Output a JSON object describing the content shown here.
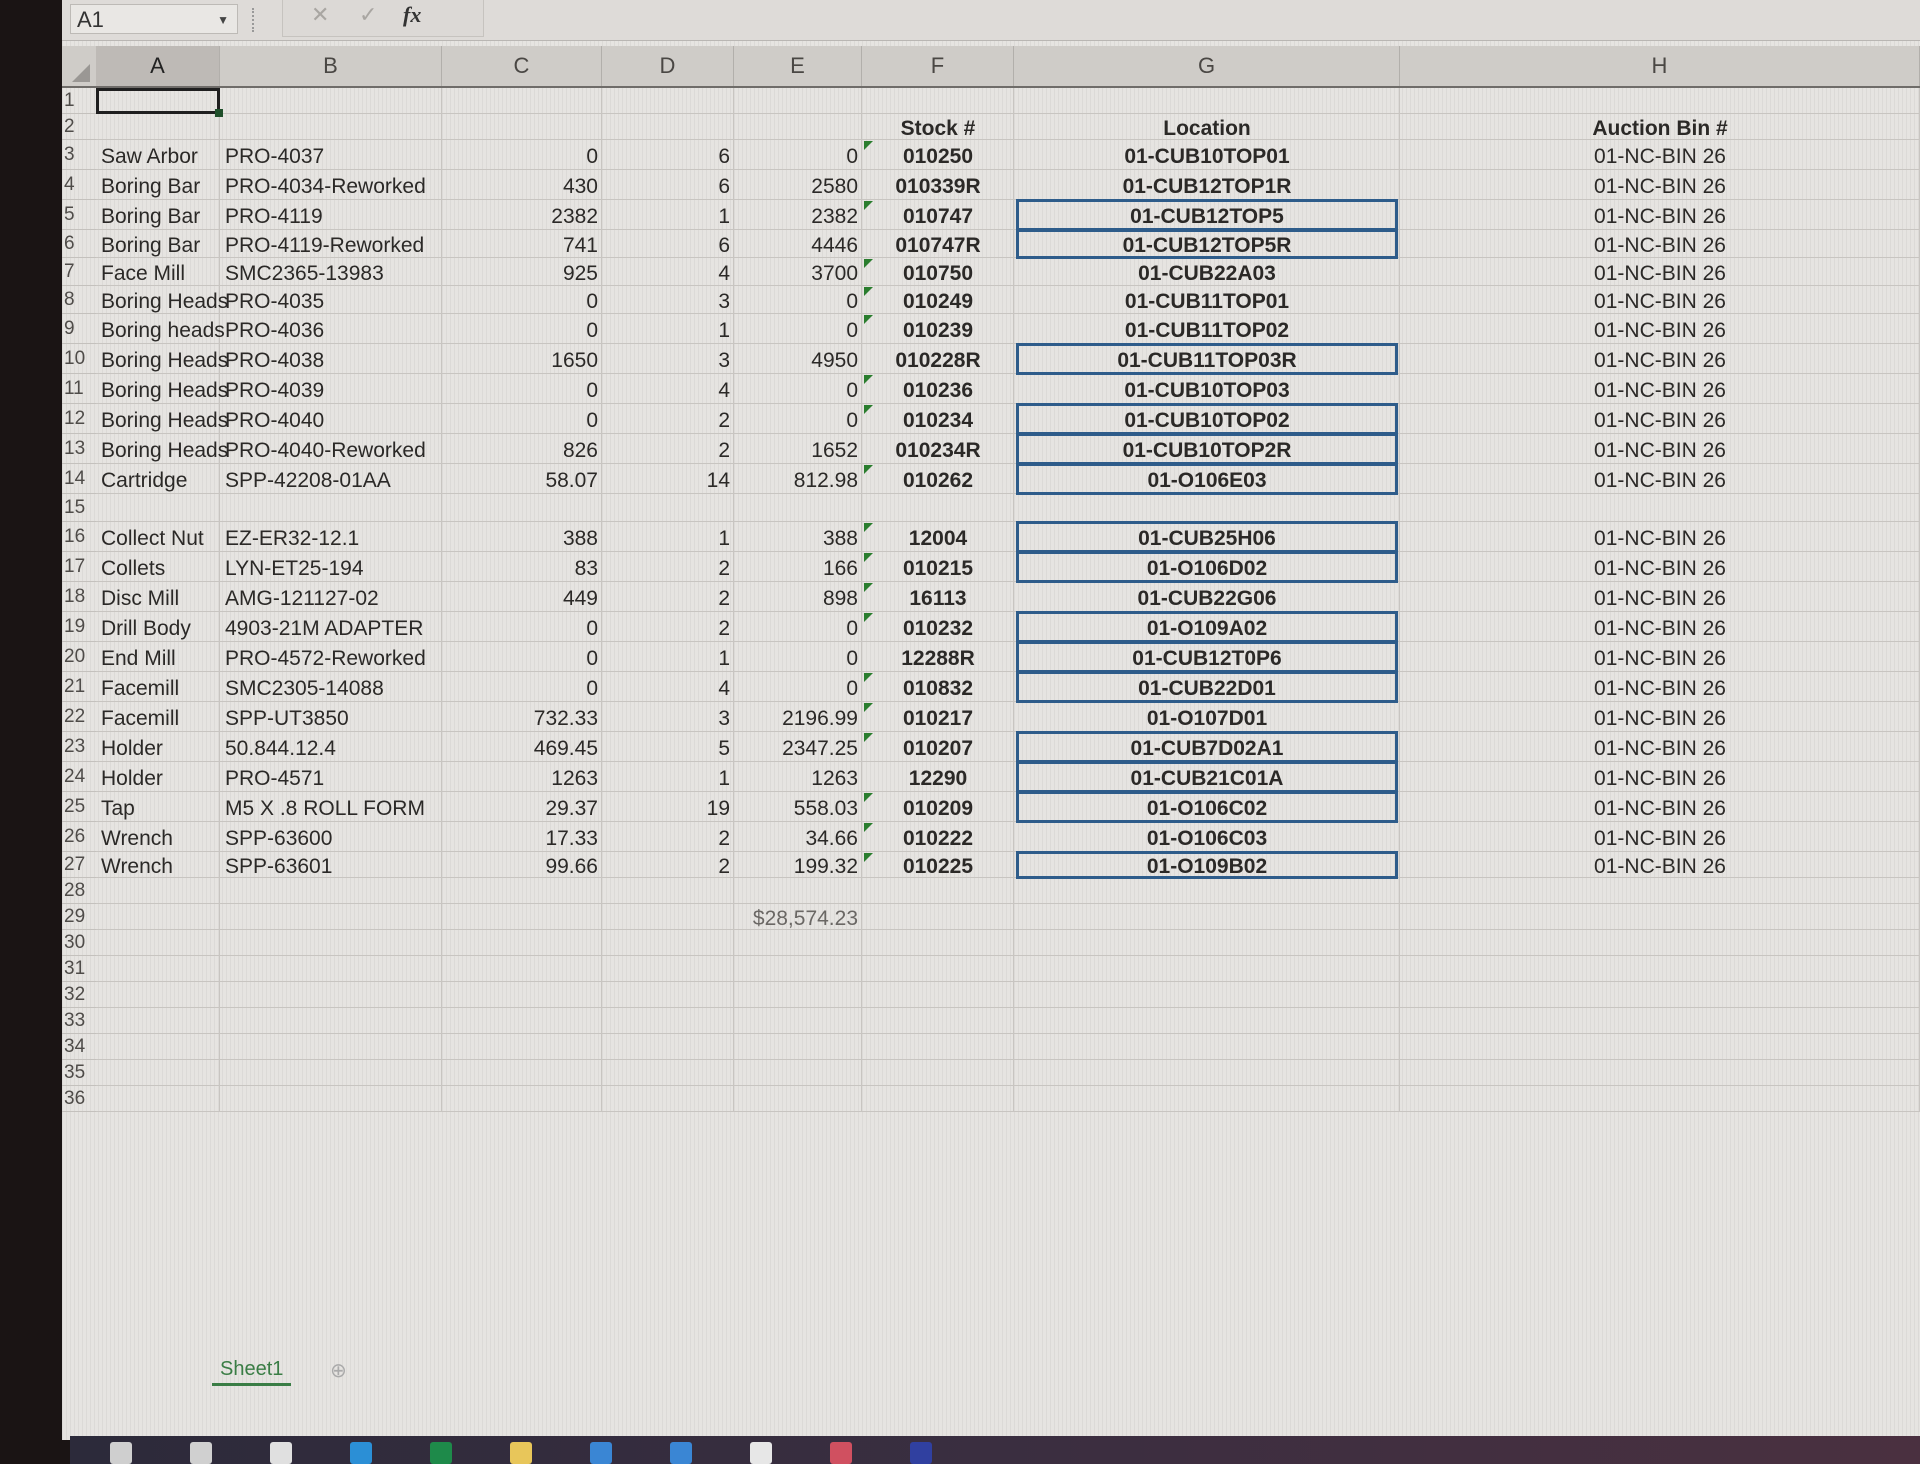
{
  "formula_bar": {
    "name_box": "A1",
    "cancel_icon": "✕",
    "enter_icon": "✓",
    "fx_label": "fx",
    "formula": ""
  },
  "columns": [
    "A",
    "B",
    "C",
    "D",
    "E",
    "F",
    "G",
    "H"
  ],
  "row_numbers": [
    "1",
    "2",
    "3",
    "4",
    "5",
    "6",
    "7",
    "8",
    "9",
    "10",
    "11",
    "12",
    "13",
    "14",
    "15",
    "16",
    "17",
    "18",
    "19",
    "20",
    "21",
    "22",
    "23",
    "24",
    "25",
    "26",
    "27",
    "28",
    "29",
    "30",
    "31",
    "32",
    "33",
    "34",
    "35",
    "36"
  ],
  "headers": {
    "stock": "Stock #",
    "location": "Location",
    "auction_bin": "Auction Bin #"
  },
  "rows": [
    {
      "row": 3,
      "a": "Saw Arbor",
      "b": "PRO-4037",
      "c": "0",
      "d": "6",
      "e": "0",
      "f": "010250",
      "g": "01-CUB10TOP01",
      "h": "01-NC-BIN 26",
      "flag": true,
      "boxed": false
    },
    {
      "row": 4,
      "a": "Boring Bar",
      "b": "PRO-4034-Reworked",
      "c": "430",
      "d": "6",
      "e": "2580",
      "f": "010339R",
      "g": "01-CUB12TOP1R",
      "h": "01-NC-BIN 26",
      "flag": false,
      "boxed": false
    },
    {
      "row": 5,
      "a": "Boring Bar",
      "b": "PRO-4119",
      "c": "2382",
      "d": "1",
      "e": "2382",
      "f": "010747",
      "g": "01-CUB12TOP5",
      "h": "01-NC-BIN 26",
      "flag": true,
      "boxed": true
    },
    {
      "row": 6,
      "a": "Boring Bar",
      "b": "PRO-4119-Reworked",
      "c": "741",
      "d": "6",
      "e": "4446",
      "f": "010747R",
      "g": "01-CUB12TOP5R",
      "h": "01-NC-BIN 26",
      "flag": false,
      "boxed": true
    },
    {
      "row": 7,
      "a": "Face Mill",
      "b": "SMC2365-13983",
      "c": "925",
      "d": "4",
      "e": "3700",
      "f": "010750",
      "g": "01-CUB22A03",
      "h": "01-NC-BIN 26",
      "flag": true,
      "boxed": false
    },
    {
      "row": 8,
      "a": "Boring Heads",
      "b": "PRO-4035",
      "c": "0",
      "d": "3",
      "e": "0",
      "f": "010249",
      "g": "01-CUB11TOP01",
      "h": "01-NC-BIN 26",
      "flag": true,
      "boxed": false
    },
    {
      "row": 9,
      "a": "Boring heads",
      "b": "PRO-4036",
      "c": "0",
      "d": "1",
      "e": "0",
      "f": "010239",
      "g": "01-CUB11TOP02",
      "h": "01-NC-BIN 26",
      "flag": true,
      "boxed": false
    },
    {
      "row": 10,
      "a": "Boring Heads",
      "b": "PRO-4038",
      "c": "1650",
      "d": "3",
      "e": "4950",
      "f": "010228R",
      "g": "01-CUB11TOP03R",
      "h": "01-NC-BIN 26",
      "flag": false,
      "boxed": true
    },
    {
      "row": 11,
      "a": "Boring Heads",
      "b": "PRO-4039",
      "c": "0",
      "d": "4",
      "e": "0",
      "f": "010236",
      "g": "01-CUB10TOP03",
      "h": "01-NC-BIN 26",
      "flag": true,
      "boxed": false
    },
    {
      "row": 12,
      "a": "Boring Heads",
      "b": "PRO-4040",
      "c": "0",
      "d": "2",
      "e": "0",
      "f": "010234",
      "g": "01-CUB10TOP02",
      "h": "01-NC-BIN 26",
      "flag": true,
      "boxed": true
    },
    {
      "row": 13,
      "a": "Boring Heads",
      "b": "PRO-4040-Reworked",
      "c": "826",
      "d": "2",
      "e": "1652",
      "f": "010234R",
      "g": "01-CUB10TOP2R",
      "h": "01-NC-BIN 26",
      "flag": false,
      "boxed": true
    },
    {
      "row": 14,
      "a": "Cartridge",
      "b": "SPP-42208-01AA",
      "c": "58.07",
      "d": "14",
      "e": "812.98",
      "f": "010262",
      "g": "01-O106E03",
      "h": "01-NC-BIN 26",
      "flag": true,
      "boxed": true
    },
    {
      "row": 16,
      "a": "Collect Nut",
      "b": "EZ-ER32-12.1",
      "c": "388",
      "d": "1",
      "e": "388",
      "f": "12004",
      "g": "01-CUB25H06",
      "h": "01-NC-BIN 26",
      "flag": true,
      "boxed": true
    },
    {
      "row": 17,
      "a": "Collets",
      "b": "LYN-ET25-194",
      "c": "83",
      "d": "2",
      "e": "166",
      "f": "010215",
      "g": "01-O106D02",
      "h": "01-NC-BIN 26",
      "flag": true,
      "boxed": true
    },
    {
      "row": 18,
      "a": "Disc Mill",
      "b": "AMG-121127-02",
      "c": "449",
      "d": "2",
      "e": "898",
      "f": "16113",
      "g": "01-CUB22G06",
      "h": "01-NC-BIN 26",
      "flag": true,
      "boxed": false
    },
    {
      "row": 19,
      "a": "Drill Body",
      "b": " 4903-21M ADAPTER",
      "c": "0",
      "d": "2",
      "e": "0",
      "f": "010232",
      "g": "01-O109A02",
      "h": "01-NC-BIN 26",
      "flag": true,
      "boxed": true
    },
    {
      "row": 20,
      "a": "End Mill",
      "b": "PRO-4572-Reworked",
      "c": "0",
      "d": "1",
      "e": "0",
      "f": "12288R",
      "g": "01-CUB12T0P6",
      "h": "01-NC-BIN 26",
      "flag": false,
      "boxed": true
    },
    {
      "row": 21,
      "a": "Facemill",
      "b": "SMC2305-14088",
      "c": "0",
      "d": "4",
      "e": "0",
      "f": "010832",
      "g": "01-CUB22D01",
      "h": "01-NC-BIN 26",
      "flag": true,
      "boxed": true
    },
    {
      "row": 22,
      "a": "Facemill",
      "b": "SPP-UT3850",
      "c": "732.33",
      "d": "3",
      "e": "2196.99",
      "f": "010217",
      "g": "01-O107D01",
      "h": "01-NC-BIN 26",
      "flag": true,
      "boxed": false
    },
    {
      "row": 23,
      "a": "Holder",
      "b": "50.844.12.4",
      "c": "469.45",
      "d": "5",
      "e": "2347.25",
      "f": "010207",
      "g": "01-CUB7D02A1",
      "h": "01-NC-BIN 26",
      "flag": true,
      "boxed": true
    },
    {
      "row": 24,
      "a": "Holder",
      "b": "PRO-4571",
      "c": "1263",
      "d": "1",
      "e": "1263",
      "f": "12290",
      "g": "01-CUB21C01A",
      "h": "01-NC-BIN 26",
      "flag": false,
      "boxed": true
    },
    {
      "row": 25,
      "a": "Tap",
      "b": "M5 X .8 ROLL FORM",
      "c": "29.37",
      "d": "19",
      "e": "558.03",
      "f": "010209",
      "g": "01-O106C02",
      "h": "01-NC-BIN 26",
      "flag": true,
      "boxed": true
    },
    {
      "row": 26,
      "a": "Wrench",
      "b": "SPP-63600",
      "c": "17.33",
      "d": "2",
      "e": "34.66",
      "f": "010222",
      "g": "01-O106C03",
      "h": "01-NC-BIN 26",
      "flag": true,
      "boxed": false
    },
    {
      "row": 27,
      "a": "Wrench",
      "b": "SPP-63601",
      "c": "99.66",
      "d": "2",
      "e": "199.32",
      "f": "010225",
      "g": "01-O109B02",
      "h": "01-NC-BIN 26",
      "flag": true,
      "boxed": true
    }
  ],
  "total": {
    "row": 29,
    "value": "$28,574.23"
  },
  "sheet_tabs": [
    {
      "label": "Sheet1",
      "active": true
    }
  ],
  "add_sheet_icon": "⊕",
  "colors": {
    "location_border": "#2e5c8a",
    "error_triangle": "#2a7d2e",
    "active_sheet": "#3a7d45"
  },
  "taskbar": {
    "icons": [
      "start-icon",
      "search-icon",
      "task-view-icon",
      "edge-icon",
      "excel-icon",
      "file-explorer-icon",
      "app-icon",
      "app-icon",
      "app-icon",
      "app-icon",
      "app-icon"
    ]
  }
}
